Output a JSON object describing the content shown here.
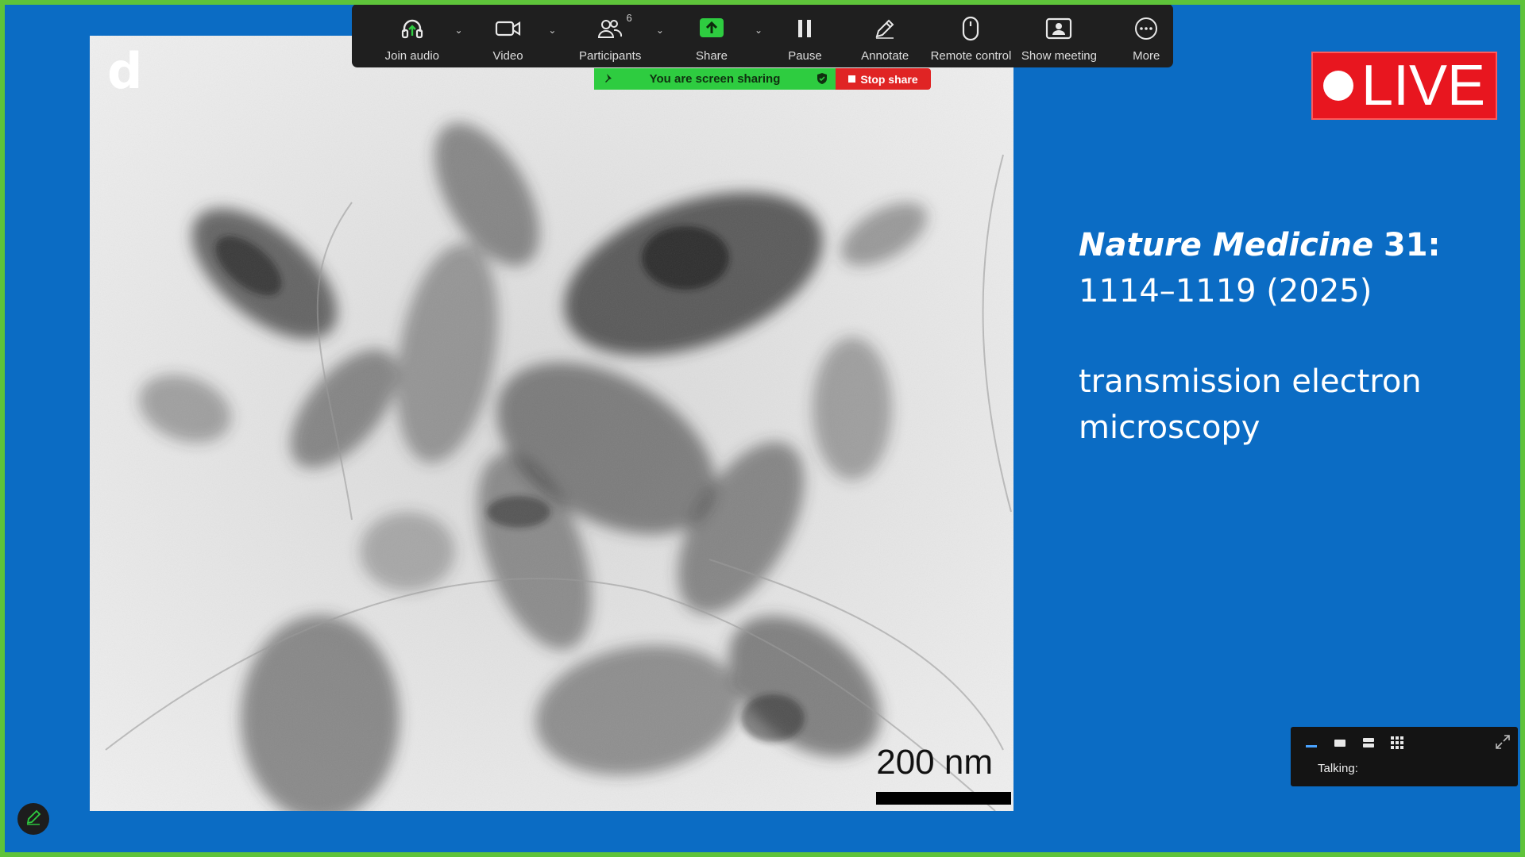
{
  "toolbar": {
    "items": [
      {
        "label": "Join audio",
        "icon": "headphones-icon"
      },
      {
        "label": "Video",
        "icon": "video-camera-icon"
      },
      {
        "label": "Participants",
        "icon": "participants-icon",
        "count": "6"
      },
      {
        "label": "Share",
        "icon": "share-screen-icon"
      },
      {
        "label": "Pause",
        "icon": "pause-icon"
      },
      {
        "label": "Annotate",
        "icon": "pencil-icon"
      },
      {
        "label": "Remote control",
        "icon": "mouse-icon"
      },
      {
        "label": "Show meeting",
        "icon": "show-meeting-icon"
      },
      {
        "label": "More",
        "icon": "more-dots-icon"
      }
    ]
  },
  "share_banner": {
    "text": "You are screen sharing",
    "stop_label": "Stop share"
  },
  "live_badge": {
    "text": "LIVE"
  },
  "slide": {
    "micrograph": {
      "panel_letter": "d",
      "scale_label": "200 nm"
    },
    "citation_journal": "Nature Medicine",
    "citation_volume": "31",
    "citation_rest": ": ",
    "citation_line2": "1114–1119 (2025)",
    "description_line1": "transmission electron",
    "description_line2": "microscopy"
  },
  "mini_panel": {
    "talking_label": "Talking:"
  },
  "colors": {
    "background": "#0b6cc4",
    "frame": "#5ec33a",
    "toolbar": "#1f1f1f",
    "share_green": "#2ecc40",
    "stop_red": "#e02424",
    "live_red": "#e8161f"
  }
}
